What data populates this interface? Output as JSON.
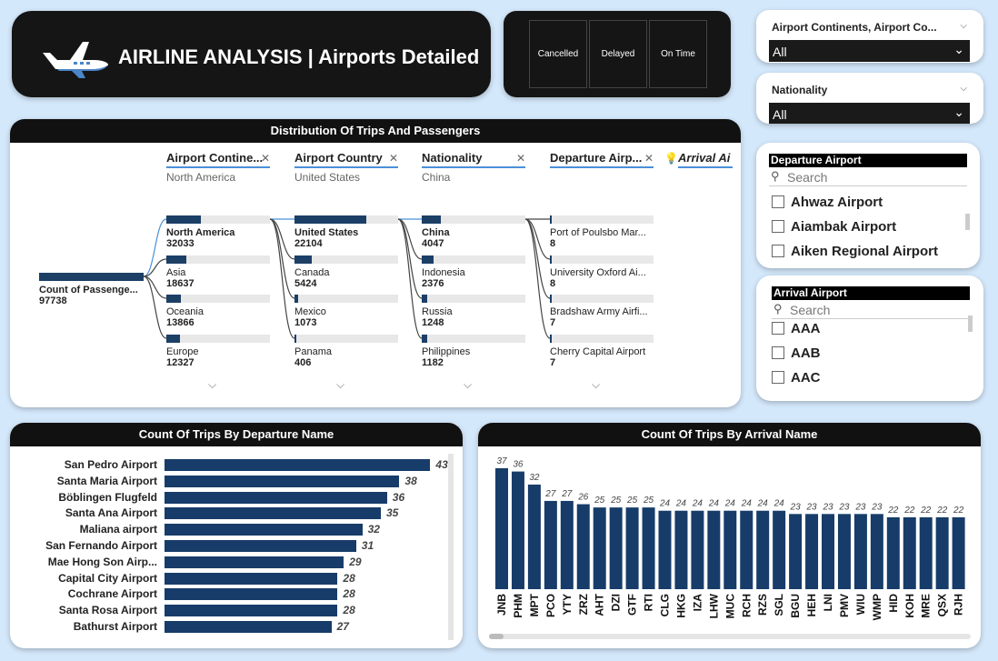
{
  "header": {
    "title": "AIRLINE ANALYSIS | Airports Detailed"
  },
  "status_buttons": [
    "Cancelled",
    "Delayed",
    "On Time"
  ],
  "filters": {
    "continent": {
      "label": "Airport Continents, Airport Co...",
      "value": "All"
    },
    "nationality": {
      "label": "Nationality",
      "value": "All"
    }
  },
  "departure_slicer": {
    "title": "Departure Airport",
    "search_placeholder": "Search",
    "items": [
      "Ahwaz Airport",
      "Aiambak Airport",
      "Aiken Regional Airport"
    ]
  },
  "arrival_slicer": {
    "title": "Arrival Airport",
    "search_placeholder": "Search",
    "items": [
      "AAA",
      "AAB",
      "AAC"
    ]
  },
  "tree": {
    "title": "Distribution Of Trips And Passengers",
    "root": {
      "label": "Count of Passenge...",
      "value": "97738"
    },
    "columns": [
      {
        "header": "Airport Contine...",
        "selected": "North America",
        "nodes": [
          {
            "label": "North America",
            "value": "32033",
            "fraction": 0.33
          },
          {
            "label": "Asia",
            "value": "18637",
            "fraction": 0.19
          },
          {
            "label": "Oceania",
            "value": "13866",
            "fraction": 0.14
          },
          {
            "label": "Europe",
            "value": "12327",
            "fraction": 0.13
          }
        ]
      },
      {
        "header": "Airport Country",
        "selected": "United States",
        "nodes": [
          {
            "label": "United States",
            "value": "22104",
            "fraction": 0.69
          },
          {
            "label": "Canada",
            "value": "5424",
            "fraction": 0.17
          },
          {
            "label": "Mexico",
            "value": "1073",
            "fraction": 0.034
          },
          {
            "label": "Panama",
            "value": "406",
            "fraction": 0.013
          }
        ]
      },
      {
        "header": "Nationality",
        "selected": "China",
        "nodes": [
          {
            "label": "China",
            "value": "4047",
            "fraction": 0.18
          },
          {
            "label": "Indonesia",
            "value": "2376",
            "fraction": 0.11
          },
          {
            "label": "Russia",
            "value": "1248",
            "fraction": 0.056
          },
          {
            "label": "Philippines",
            "value": "1182",
            "fraction": 0.053
          }
        ]
      },
      {
        "header": "Departure Airp...",
        "selected": "",
        "nodes": [
          {
            "label": "Port of Poulsbo Mar...",
            "value": "8",
            "fraction": 0.002
          },
          {
            "label": "University Oxford Ai...",
            "value": "8",
            "fraction": 0.002
          },
          {
            "label": "Bradshaw Army Airfi...",
            "value": "7",
            "fraction": 0.002
          },
          {
            "label": "Cherry Capital Airport",
            "value": "7",
            "fraction": 0.002
          }
        ]
      }
    ],
    "next_header": "Arrival Ai"
  },
  "chart_data": [
    {
      "type": "bar",
      "orientation": "horizontal",
      "title": "Count Of Trips By Departure Name",
      "categories": [
        "San Pedro Airport",
        "Santa Maria Airport",
        "Böblingen Flugfeld",
        "Santa Ana Airport",
        "Maliana airport",
        "San Fernando Airport",
        "Mae Hong Son Airp...",
        "Capital City Airport",
        "Cochrane Airport",
        "Santa Rosa Airport",
        "Bathurst Airport"
      ],
      "values": [
        43,
        38,
        36,
        35,
        32,
        31,
        29,
        28,
        28,
        28,
        27
      ]
    },
    {
      "type": "bar",
      "orientation": "vertical",
      "title": "Count Of Trips By Arrival Name",
      "categories": [
        "JNB",
        "PHM",
        "MPT",
        "PCO",
        "YTY",
        "ZRZ",
        "AHT",
        "DZI",
        "GTF",
        "RTI",
        "CLG",
        "HKG",
        "IZA",
        "LHW",
        "MUC",
        "RCH",
        "RZS",
        "SGL",
        "BGU",
        "HEH",
        "LNI",
        "PMV",
        "WIU",
        "WMP",
        "HID",
        "KOH",
        "MRE",
        "QSX",
        "RJH"
      ],
      "values": [
        37,
        36,
        32,
        27,
        27,
        26,
        25,
        25,
        25,
        25,
        24,
        24,
        24,
        24,
        24,
        24,
        24,
        24,
        23,
        23,
        23,
        23,
        23,
        23,
        22,
        22,
        22,
        22,
        22
      ]
    }
  ]
}
